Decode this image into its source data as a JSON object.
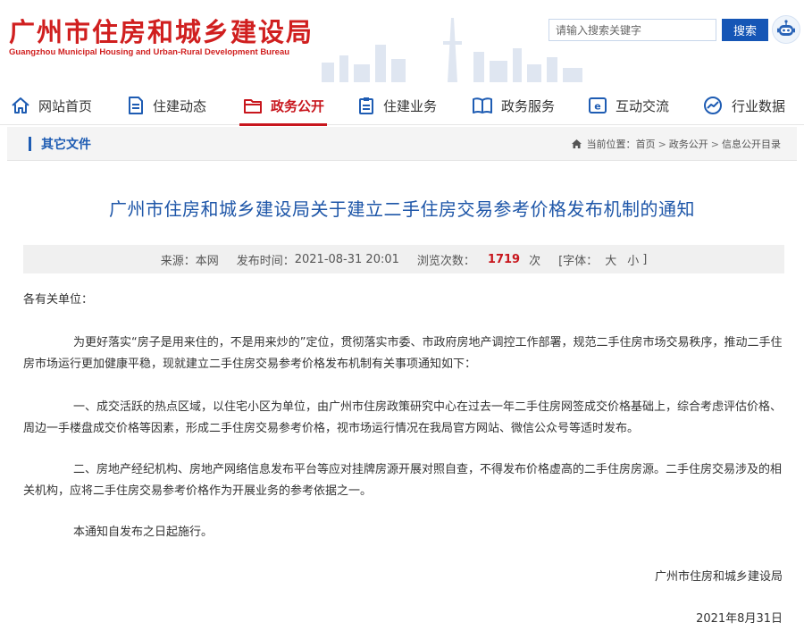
{
  "header": {
    "site_name_cn": "广州市住房和城乡建设局",
    "site_name_en": "Guangzhou Municipal Housing and Urban-Rural Development Bureau",
    "search": {
      "placeholder": "请输入搜索关键字",
      "button_label": "搜索"
    }
  },
  "nav": {
    "items": [
      {
        "label": "网站首页",
        "icon": "home-icon"
      },
      {
        "label": "住建动态",
        "icon": "document-icon"
      },
      {
        "label": "政务公开",
        "icon": "folder-icon",
        "active": true
      },
      {
        "label": "住建业务",
        "icon": "clipboard-icon"
      },
      {
        "label": "政务服务",
        "icon": "book-icon"
      },
      {
        "label": "互动交流",
        "icon": "chat-icon"
      },
      {
        "label": "行业数据",
        "icon": "chart-icon"
      }
    ],
    "active_color": "#c8161d"
  },
  "column": {
    "title": "其它文件",
    "breadcrumb": {
      "prefix": "当前位置：",
      "separator": ">",
      "items": [
        "首页",
        "政务公开",
        "信息公开目录"
      ]
    }
  },
  "article": {
    "title": "广州市住房和城乡建设局关于建立二手住房交易参考价格发布机制的通知",
    "meta": {
      "source_label": "来源：",
      "source": "本网",
      "time_label": "发布时间：",
      "time": "2021-08-31 20:01",
      "views_label": "浏览次数：",
      "views": "1719",
      "views_unit": "次",
      "font_open": "[字体：",
      "font_large": "大",
      "font_small": "小",
      "font_close": "]"
    },
    "salutation": "各有关单位：",
    "paragraphs": [
      "为更好落实“房子是用来住的，不是用来炒的”定位，贯彻落实市委、市政府房地产调控工作部署，规范二手住房市场交易秩序，推动二手住房市场运行更加健康平稳，现就建立二手住房交易参考价格发布机制有关事项通知如下：",
      "一、成交活跃的热点区域，以住宅小区为单位，由广州市住房政策研究中心在过去一年二手住房网签成交价格基础上，综合考虑评估价格、周边一手楼盘成交价格等因素，形成二手住房交易参考价格，视市场运行情况在我局官方网站、微信公众号等适时发布。",
      "二、房地产经纪机构、房地产网络信息发布平台等应对挂牌房源开展对照自查，不得发布价格虚高的二手住房房源。二手住房交易涉及的相关机构，应将二手住房交易参考价格作为开展业务的参考依据之一。",
      "本通知自发布之日起施行。"
    ],
    "signature": "广州市住房和城乡建设局",
    "date": "2021年8月31日"
  },
  "colors": {
    "brand_red": "#d01f1f",
    "link_blue": "#1e56a8",
    "button_blue": "#1556b6"
  }
}
